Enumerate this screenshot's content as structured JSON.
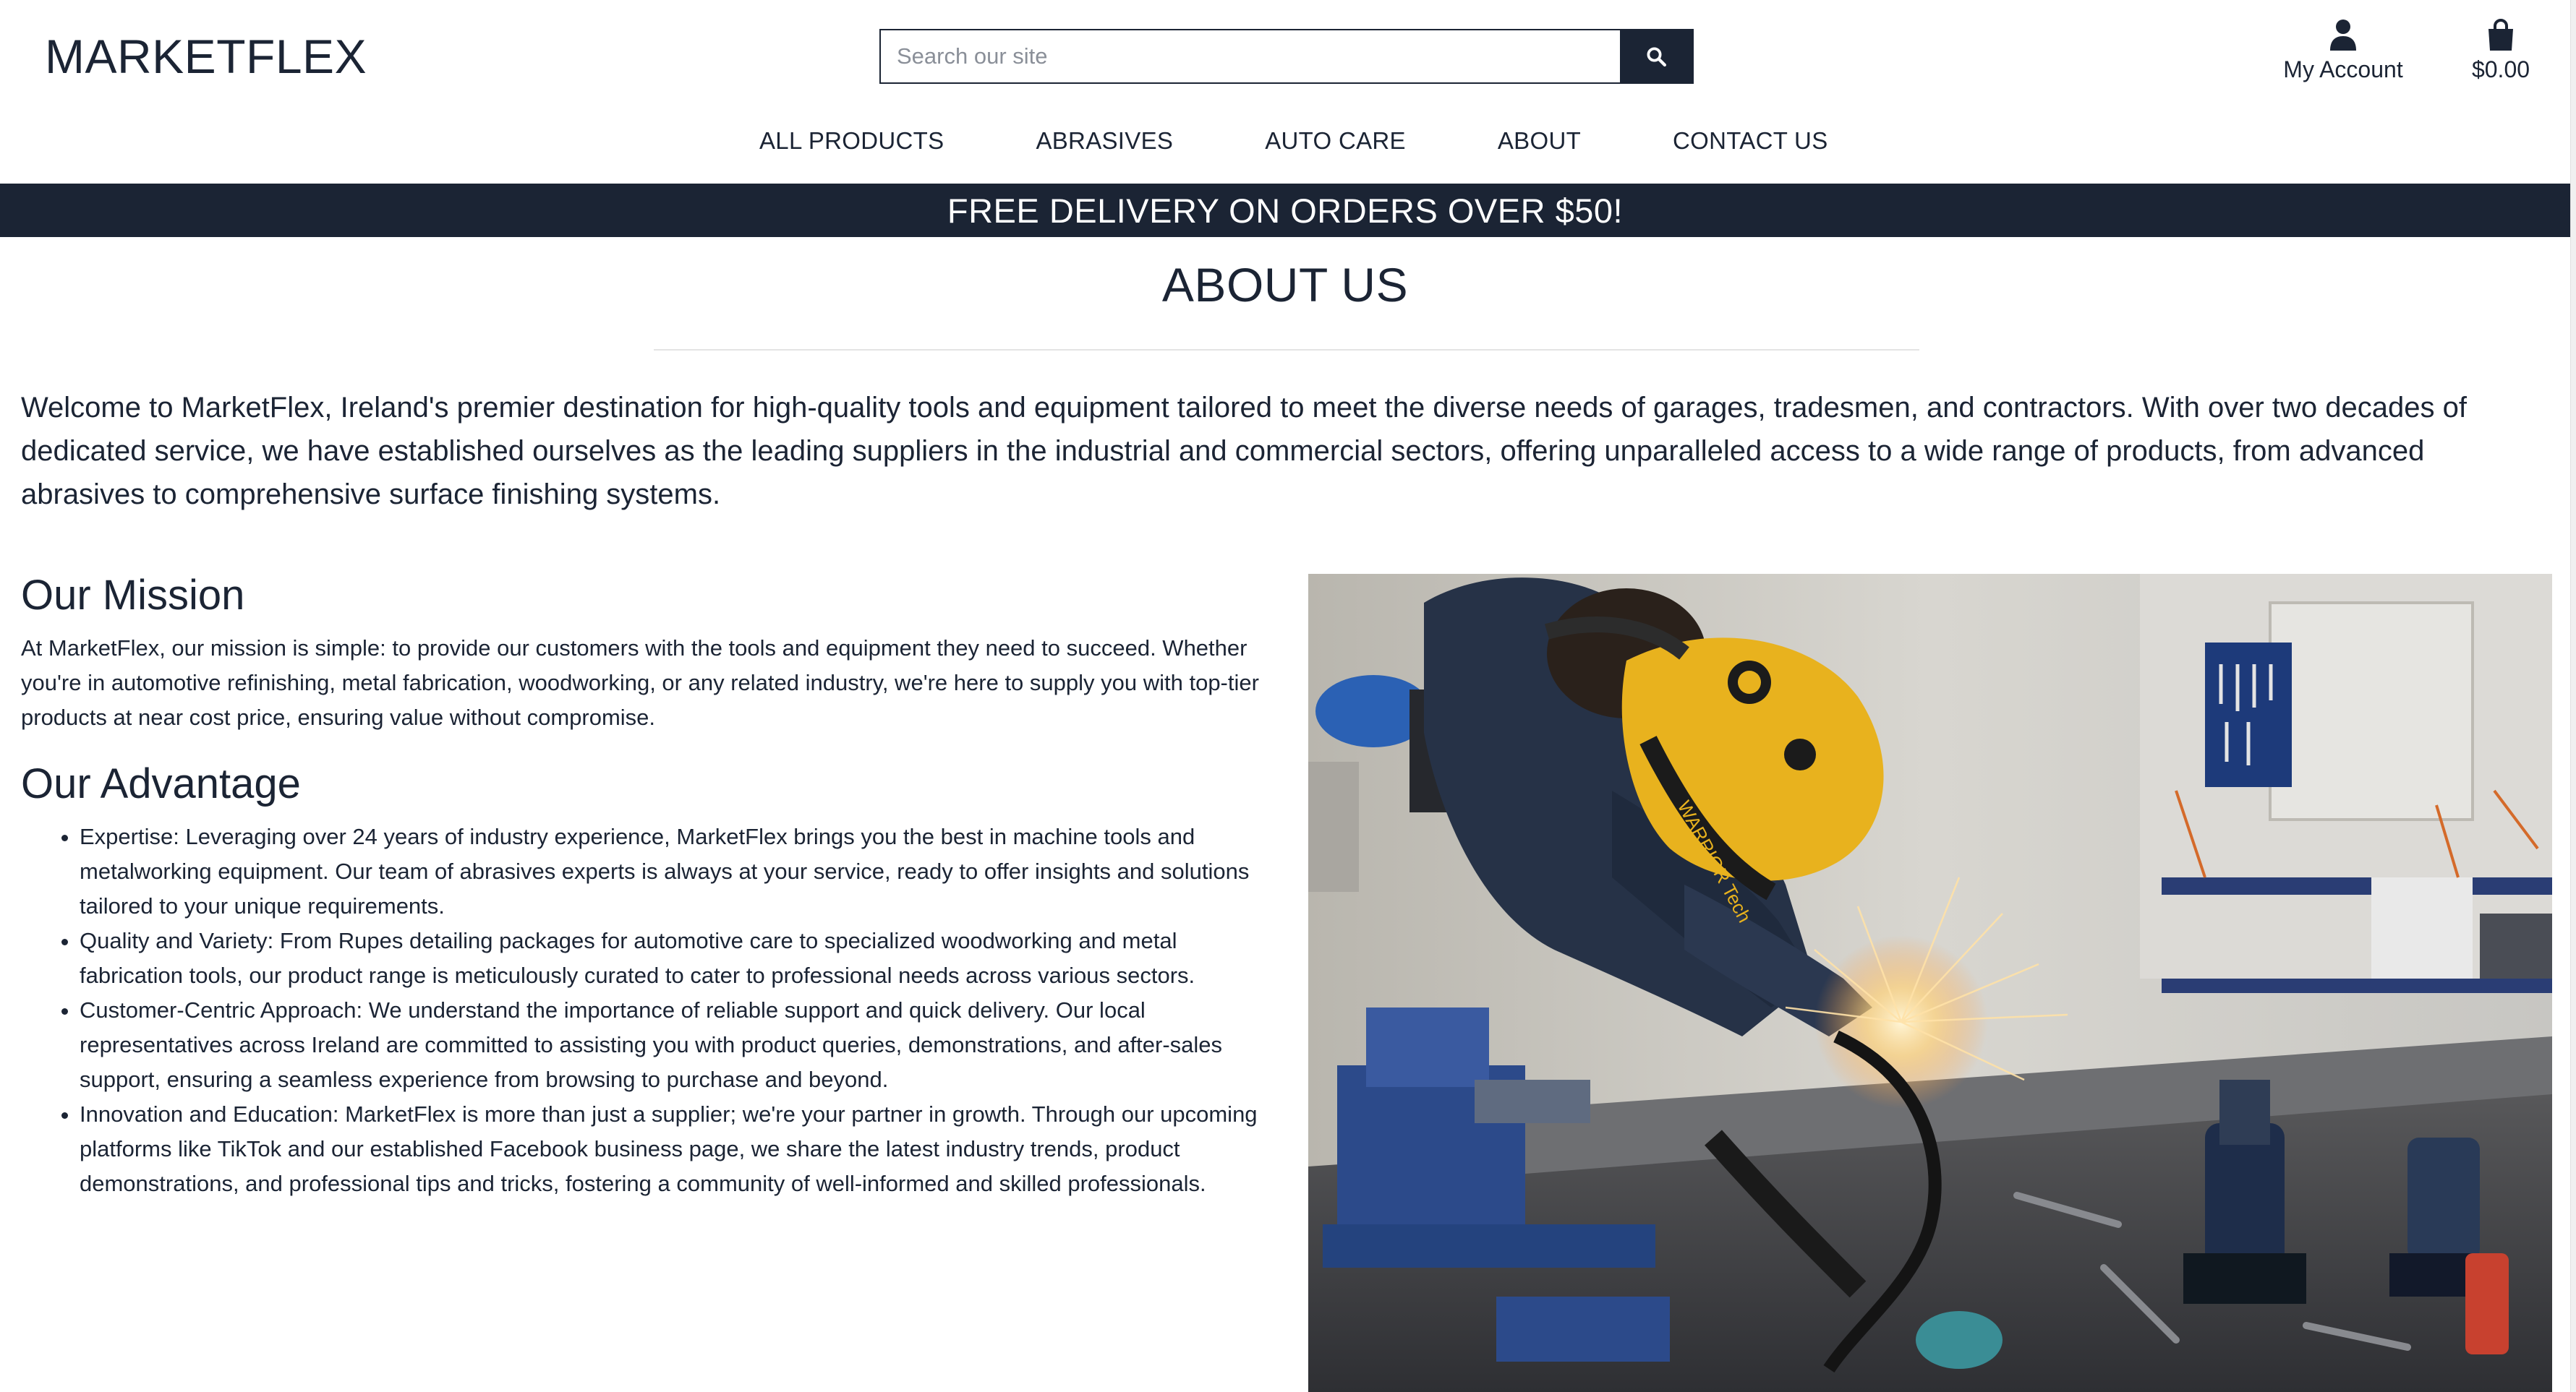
{
  "header": {
    "brand": "MARKETFLEX",
    "search_placeholder": "Search our site",
    "account_label": "My Account",
    "cart_total": "$0.00"
  },
  "nav": {
    "items": [
      "ALL PRODUCTS",
      "ABRASIVES",
      "AUTO CARE",
      "ABOUT",
      "CONTACT US"
    ]
  },
  "banner": "FREE DELIVERY ON ORDERS OVER $50!",
  "about": {
    "title": "ABOUT US",
    "intro": "Welcome to MarketFlex, Ireland's premier destination for high-quality tools and equipment tailored to meet the diverse needs of garages, tradesmen, and contractors. With over two decades of dedicated service, we have established ourselves as the leading suppliers in the industrial and commercial sectors, offering unparalleled access to a wide range of products, from advanced abrasives to comprehensive surface finishing systems.",
    "mission_heading": "Our Mission",
    "mission_text": "At MarketFlex, our mission is simple: to provide our customers with the tools and equipment they need to succeed. Whether you're in automotive refinishing, metal fabrication, woodworking, or any related industry, we're here to supply you with top-tier products at near cost price, ensuring value without compromise.",
    "advantage_heading": "Our Advantage",
    "advantages": [
      "Expertise: Leveraging over 24 years of industry experience, MarketFlex brings you the best in machine tools and metalworking equipment. Our team of abrasives experts is always at your service, ready to offer insights and solutions tailored to your unique requirements.",
      "Quality and Variety: From Rupes detailing packages for automotive care to specialized woodworking and metal fabrication tools, our product range is meticulously curated to cater to professional needs across various sectors.",
      "Customer-Centric Approach: We understand the importance of reliable support and quick delivery. Our local representatives across Ireland are committed to assisting you with product queries, demonstrations, and after-sales support, ensuring a seamless experience from browsing to purchase and beyond.",
      "Innovation and Education: MarketFlex is more than just a supplier; we're your partner in growth. Through our upcoming platforms like TikTok and our established Facebook business page, we share the latest industry trends, product demonstrations, and professional tips and tricks, fostering a community of well-informed and skilled professionals."
    ],
    "photo_helmet_text": "WARRIOR Tech"
  },
  "colors": {
    "navy": "#1b2434",
    "white": "#ffffff",
    "helmet_yellow": "#e8b21e"
  },
  "icons": [
    "search-icon",
    "user-icon",
    "shopping-bag-icon"
  ]
}
